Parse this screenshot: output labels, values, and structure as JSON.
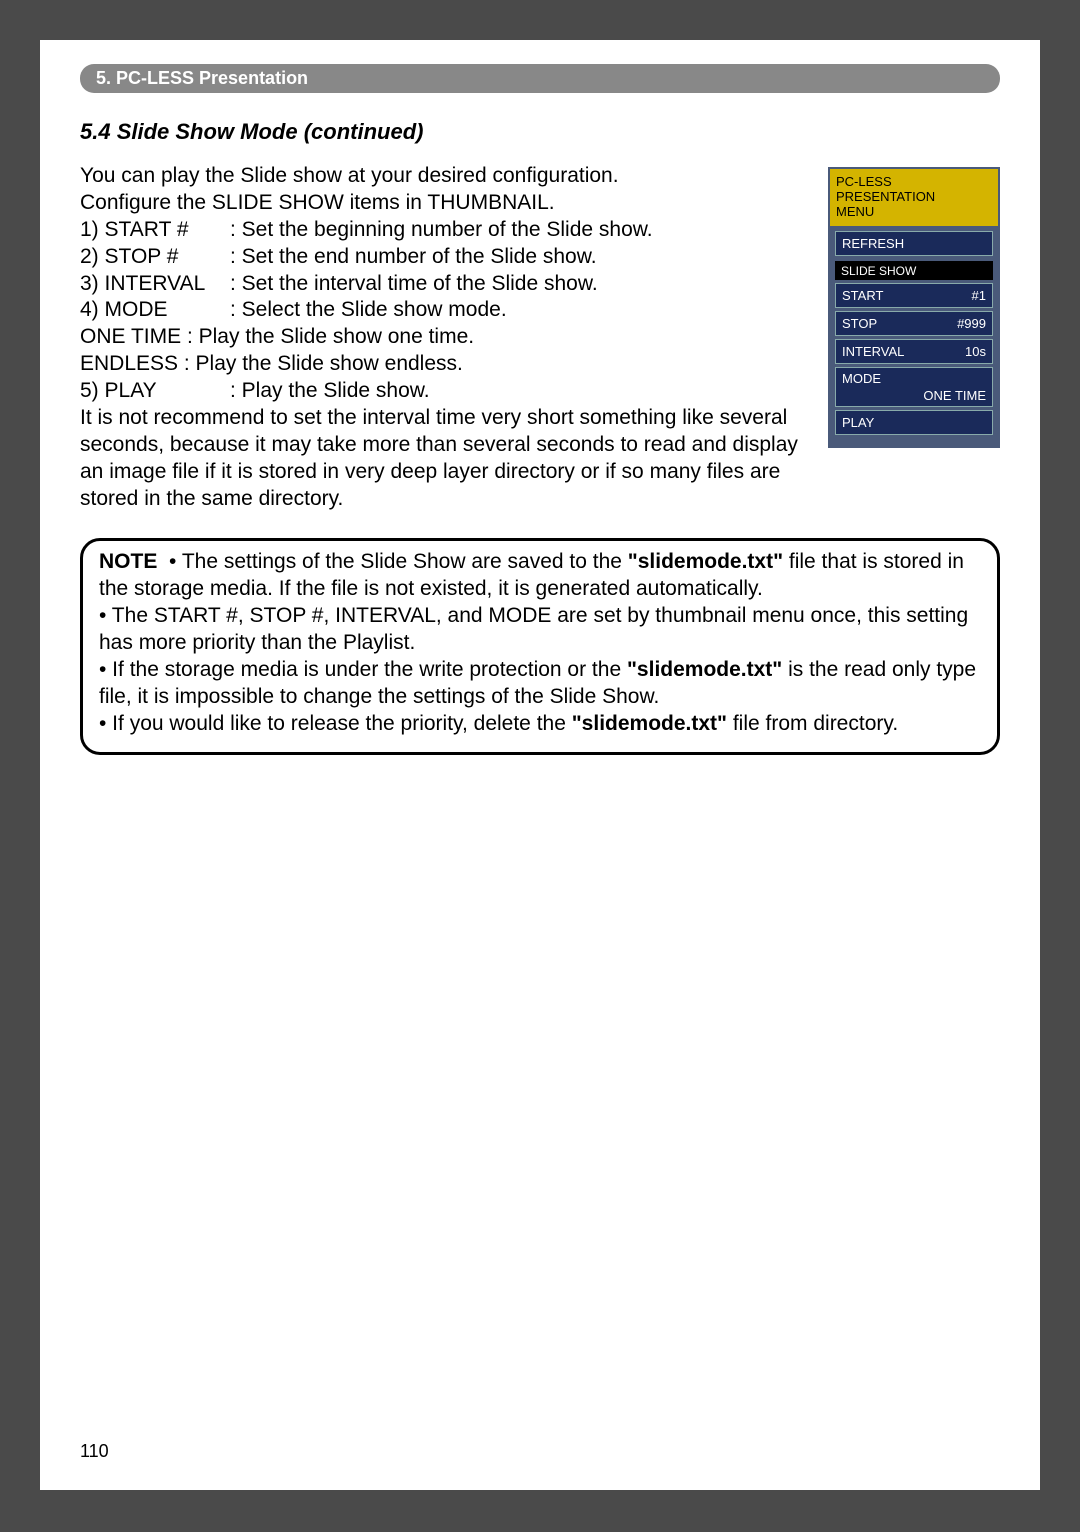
{
  "chapter": "5. PC-LESS Presentation",
  "section_title": "5.4 Slide Show Mode (continued)",
  "page_number": "110",
  "intro_line1": "You can play the Slide show at your desired configuration.",
  "intro_line2": "Configure the SLIDE SHOW items in THUMBNAIL.",
  "items": {
    "r1_label": "1) START #",
    "r1_desc": ": Set the beginning number of the Slide show.",
    "r2_label": "2) STOP #",
    "r2_desc": ": Set the end number of the Slide show.",
    "r3_label": "3) INTERVAL",
    "r3_desc": ": Set the interval time of the Slide show.",
    "r4_label": "4) MODE",
    "r4_desc": ": Select the Slide show mode.",
    "r4_sub1": "ONE TIME : Play the Slide show one time.",
    "r4_sub2": "ENDLESS : Play the Slide show endless.",
    "r5_label": "5) PLAY",
    "r5_desc": ": Play the Slide show.",
    "r5_extra": "It is not recommend to set the interval time very short something like several seconds, because it may take more than several seconds to read and display an image file if it is stored in very deep layer directory or if so many files are stored in the same directory."
  },
  "osd": {
    "header_l1": "PC-LESS",
    "header_l2": "PRESENTATION",
    "header_l3": "MENU",
    "refresh": "REFRESH",
    "group_title": "SLIDE SHOW",
    "start_label": "START",
    "start_value": "#1",
    "stop_label": "STOP",
    "stop_value": "#999",
    "interval_label": "INTERVAL",
    "interval_value": "10s",
    "mode_label": "MODE",
    "mode_value": "ONE TIME",
    "play_label": "PLAY"
  },
  "note": {
    "label": "NOTE",
    "bullet": "•",
    "p1a": " The settings of the Slide Show are saved to the ",
    "p1b": "\"slidemode.txt\"",
    "p1c": " file that is stored in the storage media. If the file is not existed, it is generated automatically.",
    "p2": "• The START #, STOP #, INTERVAL, and MODE are set by thumbnail menu once, this setting has more priority than the Playlist.",
    "p3a": "• If the storage media is under the write protection or the ",
    "p3b": "\"slidemode.txt\"",
    "p3c": " is the read only type file, it is impossible to change the settings of the Slide Show.",
    "p4a": "• If you would like to release the priority, delete the ",
    "p4b": "\"slidemode.txt\"",
    "p4c": " file from directory."
  }
}
